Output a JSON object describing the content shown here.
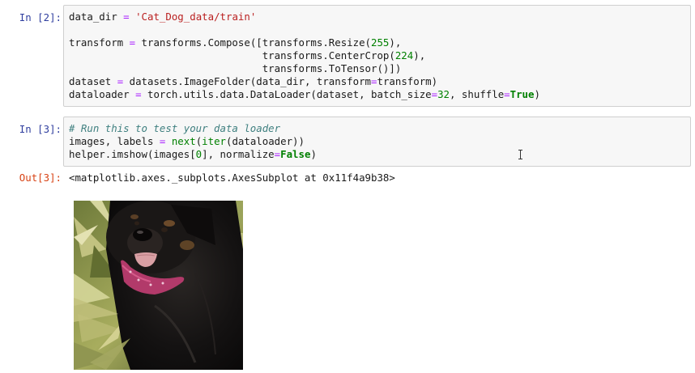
{
  "cells": [
    {
      "prompt": "In [2]:",
      "lines": [
        [
          [
            "var",
            "data_dir"
          ],
          [
            "punct",
            " "
          ],
          [
            "op",
            "="
          ],
          [
            "punct",
            " "
          ],
          [
            "str",
            "'Cat_Dog_data/train'"
          ]
        ],
        [],
        [
          [
            "var",
            "transform"
          ],
          [
            "punct",
            " "
          ],
          [
            "op",
            "="
          ],
          [
            "punct",
            " transforms.Compose([transforms.Resize("
          ],
          [
            "num",
            "255"
          ],
          [
            "punct",
            "),"
          ]
        ],
        [
          [
            "punct",
            "                                transforms.CenterCrop("
          ],
          [
            "num",
            "224"
          ],
          [
            "punct",
            "),"
          ]
        ],
        [
          [
            "punct",
            "                                transforms.ToTensor()])"
          ]
        ],
        [
          [
            "var",
            "dataset"
          ],
          [
            "punct",
            " "
          ],
          [
            "op",
            "="
          ],
          [
            "punct",
            " datasets.ImageFolder(data_dir, transform"
          ],
          [
            "op",
            "="
          ],
          [
            "punct",
            "transform)"
          ]
        ],
        [
          [
            "var",
            "dataloader"
          ],
          [
            "punct",
            " "
          ],
          [
            "op",
            "="
          ],
          [
            "punct",
            " torch.utils.data.DataLoader(dataset, batch_size"
          ],
          [
            "op",
            "="
          ],
          [
            "num",
            "32"
          ],
          [
            "punct",
            ", shuffle"
          ],
          [
            "op",
            "="
          ],
          [
            "kw",
            "True"
          ],
          [
            "punct",
            ")"
          ]
        ]
      ]
    },
    {
      "prompt": "In [3]:",
      "lines": [
        [
          [
            "comment",
            "# Run this to test your data loader"
          ]
        ],
        [
          [
            "var",
            "images, labels"
          ],
          [
            "punct",
            " "
          ],
          [
            "op",
            "="
          ],
          [
            "punct",
            " "
          ],
          [
            "builtin",
            "next"
          ],
          [
            "punct",
            "("
          ],
          [
            "builtin",
            "iter"
          ],
          [
            "punct",
            "(dataloader))"
          ]
        ],
        [
          [
            "var",
            "helper.imshow(images["
          ],
          [
            "num",
            "0"
          ],
          [
            "punct",
            "], normalize"
          ],
          [
            "op",
            "="
          ],
          [
            "kw",
            "False"
          ],
          [
            "punct",
            ")"
          ]
        ]
      ]
    }
  ],
  "output": {
    "prompt": "Out[3]:",
    "text": "<matplotlib.axes._subplots.AxesSubplot at 0x11f4a9b38>",
    "image_icon": "black-dog-with-pink-bandana-image"
  },
  "colors": {
    "in_prompt": "#303f9f",
    "out_prompt": "#d84315",
    "cell_bg": "#f7f7f7",
    "cell_border": "#cfcfcf",
    "string": "#ba2121",
    "number": "#008000",
    "keyword": "#008000",
    "operator": "#aa22ff",
    "comment": "#408080"
  }
}
